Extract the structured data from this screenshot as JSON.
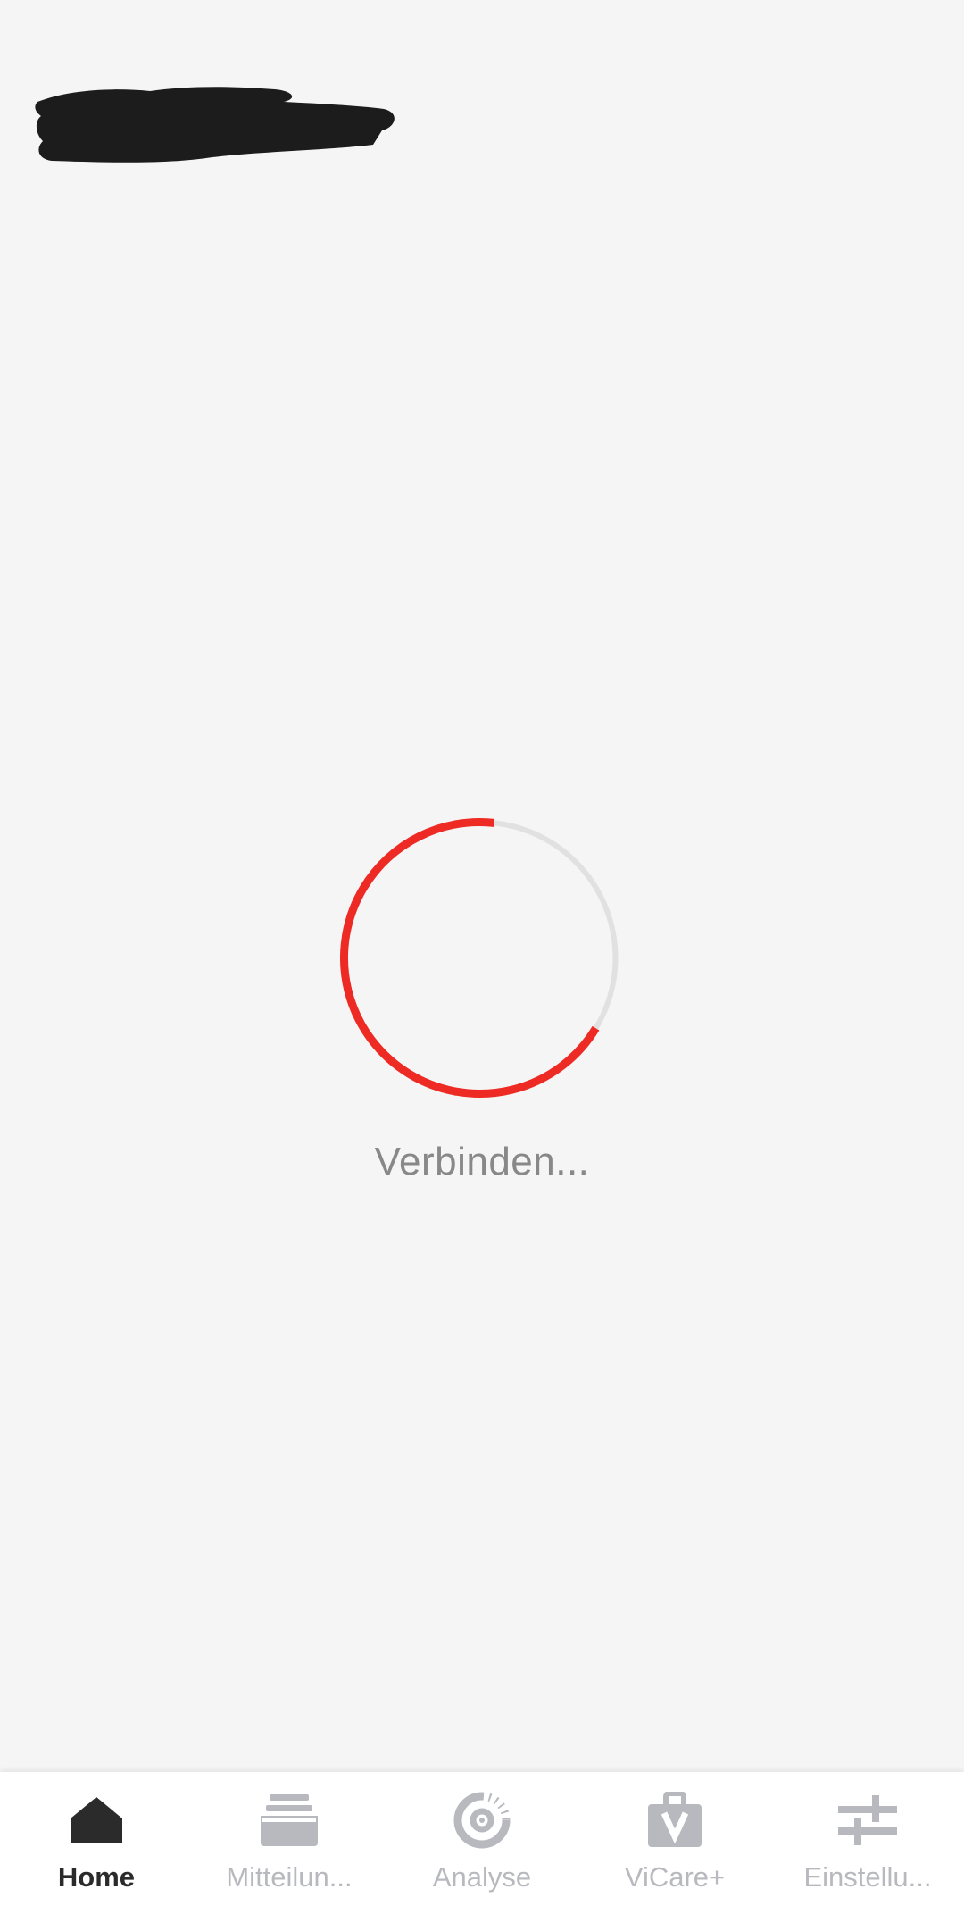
{
  "loader": {
    "status_text": "Verbinden...",
    "progress_fraction": 0.68,
    "accent_color": "#ee2a24",
    "track_color": "#e1e1e1"
  },
  "bottom_nav": {
    "items": [
      {
        "label": "Home",
        "icon": "home-icon",
        "active": true
      },
      {
        "label": "Mitteilun...",
        "icon": "inbox-icon",
        "active": false
      },
      {
        "label": "Analyse",
        "icon": "analysis-icon",
        "active": false
      },
      {
        "label": "ViCare+",
        "icon": "shopping-bag-icon",
        "active": false
      },
      {
        "label": "Einstellu...",
        "icon": "settings-sliders-icon",
        "active": false
      }
    ],
    "active_color": "#2b2b2b",
    "inactive_color": "#b8b9be"
  }
}
